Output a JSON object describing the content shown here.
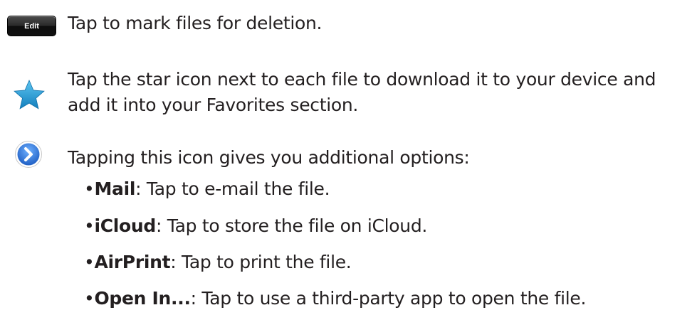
{
  "edit_row": {
    "button_label": "Edit",
    "description": "Tap to mark files for deletion."
  },
  "star_row": {
    "icon": "star-icon",
    "line1": "Tap the star icon next to each file to download it to your device and",
    "line2": "add it into your Favorites section."
  },
  "options_row": {
    "icon": "disclosure-arrow-icon",
    "intro": "Tapping this icon gives you additional options:",
    "options": [
      {
        "bullet": "•",
        "label": "Mail",
        "description": ": Tap to e-mail the file."
      },
      {
        "bullet": "•",
        "label": "iCloud",
        "description": ": Tap to store the file on iCloud."
      },
      {
        "bullet": "•",
        "label": "AirPrint",
        "description": ": Tap to print the file."
      },
      {
        "bullet": "•",
        "label": "Open In...",
        "description": ": Tap to use a third-party app to open the file."
      }
    ]
  },
  "colors": {
    "text": "#231f20",
    "star_blue": "#1e9bd7",
    "disclosure_blue": "#2a6fd6"
  }
}
